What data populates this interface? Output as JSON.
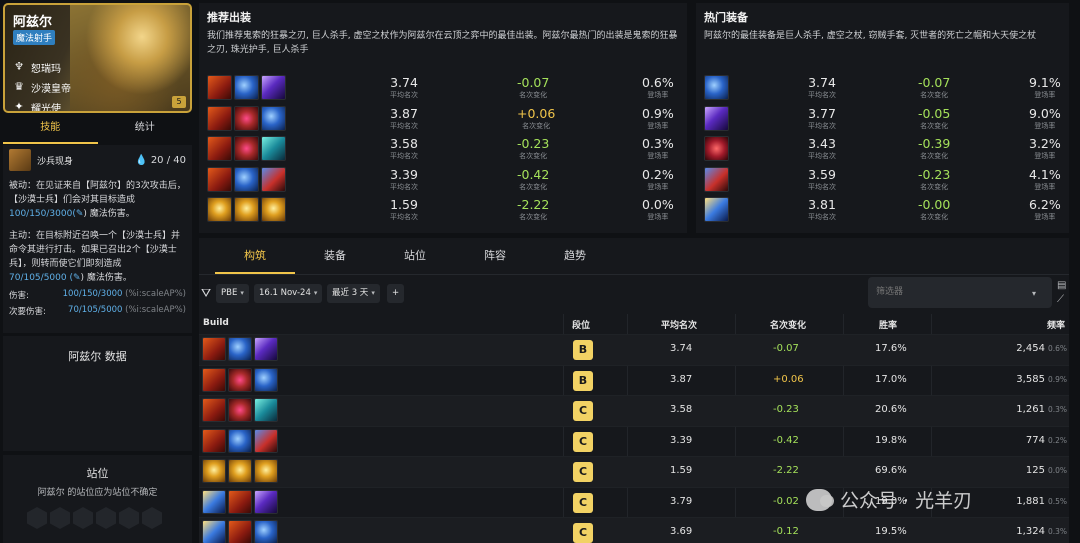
{
  "champion": {
    "name": "阿兹尔",
    "class": "魔法射手",
    "traits": [
      {
        "icon": "crown-trait-icon",
        "label": "恕瑞玛"
      },
      {
        "icon": "emperor-trait-icon",
        "label": "沙漠皇帝"
      },
      {
        "icon": "dawn-trait-icon",
        "label": "耀光使"
      }
    ],
    "cost": "5"
  },
  "left_tabs": [
    "技能",
    "统计"
  ],
  "ability": {
    "name": "沙兵现身",
    "mana": "20 / 40",
    "passive_prefix": "被动：在见证来自【阿兹尔】的3次攻击后，【沙漠士兵】们会对其目标造成",
    "passive_value": "100/150/3000(",
    "passive_suffix": ") 魔法伤害。",
    "active_prefix": "主动：在目标附近召唤一个【沙漠士兵】并命令其进行打击。如果已召出2个【沙漠士兵】，则转而使它们即刻造成",
    "active_value": "70/105/5000 (",
    "active_suffix": ") 魔法伤害。",
    "stats": [
      {
        "label": "伤害:",
        "value": "100/150/3000",
        "extra": "(%i:scaleAP%)"
      },
      {
        "label": "次要伤害:",
        "value": "70/105/5000",
        "extra": "(%i:scaleAP%)"
      }
    ]
  },
  "data_box": {
    "title": "阿兹尔 数据"
  },
  "position_box": {
    "title": "站位",
    "text": "阿兹尔 的站位应为站位不确定"
  },
  "recommended": {
    "title": "推荐出装",
    "desc": "我们推荐鬼索的狂暴之刃, 巨人杀手, 虚空之杖作为阿兹尔在云顶之弈中的最佳出装。阿兹尔最热门的出装是鬼索的狂暴之刃, 珠光护手, 巨人杀手",
    "avg_label": "平均名次",
    "chg_label": "名次变化",
    "rate_label": "登场率",
    "rows": [
      {
        "items": [
          "i-rage",
          "i-blue",
          "i-void"
        ],
        "avg": "3.74",
        "chg": "-0.07",
        "rate": "0.6%"
      },
      {
        "items": [
          "i-rage",
          "i-gaunt",
          "i-blue"
        ],
        "avg": "3.87",
        "chg": "+0.06",
        "rate": "0.9%"
      },
      {
        "items": [
          "i-rage",
          "i-gaunt",
          "i-teal"
        ],
        "avg": "3.58",
        "chg": "-0.23",
        "rate": "0.3%"
      },
      {
        "items": [
          "i-rage",
          "i-blue",
          "i-red"
        ],
        "avg": "3.39",
        "chg": "-0.42",
        "rate": "0.2%"
      },
      {
        "items": [
          "i-gold",
          "i-gold",
          "i-gold"
        ],
        "avg": "1.59",
        "chg": "-2.22",
        "rate": "0.0%"
      }
    ]
  },
  "hot": {
    "title": "热门装备",
    "desc": "阿兹尔的最佳装备是巨人杀手, 虚空之杖, 窃贼手套, 灭世者的死亡之帽和大天使之杖",
    "rows": [
      {
        "item": "i-blue",
        "avg": "3.74",
        "chg": "-0.07",
        "rate": "9.1%"
      },
      {
        "item": "i-void",
        "avg": "3.77",
        "chg": "-0.05",
        "rate": "9.0%"
      },
      {
        "item": "i-claw",
        "avg": "3.43",
        "chg": "-0.39",
        "rate": "3.2%"
      },
      {
        "item": "i-red",
        "avg": "3.59",
        "chg": "-0.23",
        "rate": "4.1%"
      },
      {
        "item": "i-spear",
        "avg": "3.81",
        "chg": "-0.00",
        "rate": "6.2%"
      }
    ]
  },
  "main_tabs": [
    "构筑",
    "装备",
    "站位",
    "阵容",
    "趋势"
  ],
  "filters": {
    "patch": "PBE",
    "version": "16.1 Nov-24",
    "range": "最近 3 天",
    "add": "+",
    "placeholder": "筛选器"
  },
  "table": {
    "headers": {
      "build": "Build",
      "tier": "段位",
      "avg": "平均名次",
      "chg": "名次变化",
      "win": "胜率",
      "freq": "频率"
    },
    "rows": [
      {
        "items": [
          "i-rage",
          "i-blue",
          "i-void"
        ],
        "tier": "B",
        "avg": "3.74",
        "chg": "-0.07",
        "win": "17.6%",
        "freq": "2,454",
        "pct": "0.6%"
      },
      {
        "items": [
          "i-rage",
          "i-gaunt",
          "i-blue"
        ],
        "tier": "B",
        "avg": "3.87",
        "chg": "+0.06",
        "win": "17.0%",
        "freq": "3,585",
        "pct": "0.9%"
      },
      {
        "items": [
          "i-rage",
          "i-gaunt",
          "i-teal"
        ],
        "tier": "C",
        "avg": "3.58",
        "chg": "-0.23",
        "win": "20.6%",
        "freq": "1,261",
        "pct": "0.3%"
      },
      {
        "items": [
          "i-rage",
          "i-blue",
          "i-red"
        ],
        "tier": "C",
        "avg": "3.39",
        "chg": "-0.42",
        "win": "19.8%",
        "freq": "774",
        "pct": "0.2%"
      },
      {
        "items": [
          "i-gold",
          "i-gold",
          "i-gold"
        ],
        "tier": "C",
        "avg": "1.59",
        "chg": "-2.22",
        "win": "69.6%",
        "freq": "125",
        "pct": "0.0%"
      },
      {
        "items": [
          "i-spear",
          "i-rage",
          "i-void"
        ],
        "tier": "C",
        "avg": "3.79",
        "chg": "-0.02",
        "win": "19.0%",
        "freq": "1,881",
        "pct": "0.5%"
      },
      {
        "items": [
          "i-spear",
          "i-rage",
          "i-blue"
        ],
        "tier": "C",
        "avg": "3.69",
        "chg": "-0.12",
        "win": "19.5%",
        "freq": "1,324",
        "pct": "0.3%"
      }
    ]
  },
  "watermark": "公众号 · 光羊刃"
}
